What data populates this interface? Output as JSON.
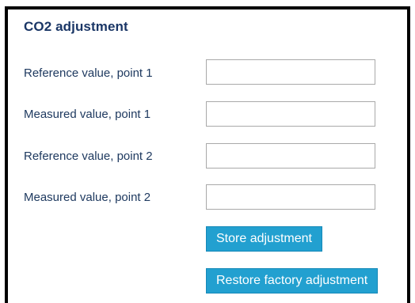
{
  "panel": {
    "title": "CO2 adjustment",
    "rows": [
      {
        "label": "Reference value, point 1",
        "value": "",
        "placeholder": ""
      },
      {
        "label": "Measured value, point 1",
        "value": "",
        "placeholder": ""
      },
      {
        "label": "Reference value, point 2",
        "value": "",
        "placeholder": ""
      },
      {
        "label": "Measured value, point 2",
        "value": "",
        "placeholder": ""
      }
    ],
    "buttons": {
      "store_label": "Store adjustment",
      "restore_label": "Restore factory adjustment"
    }
  },
  "colors": {
    "title_text": "#1a3666",
    "label_text": "#1f3a60",
    "button_bg": "#22a0d0",
    "button_text": "#ffffff",
    "field_border": "#a9a9a9",
    "panel_border": "#000000"
  }
}
